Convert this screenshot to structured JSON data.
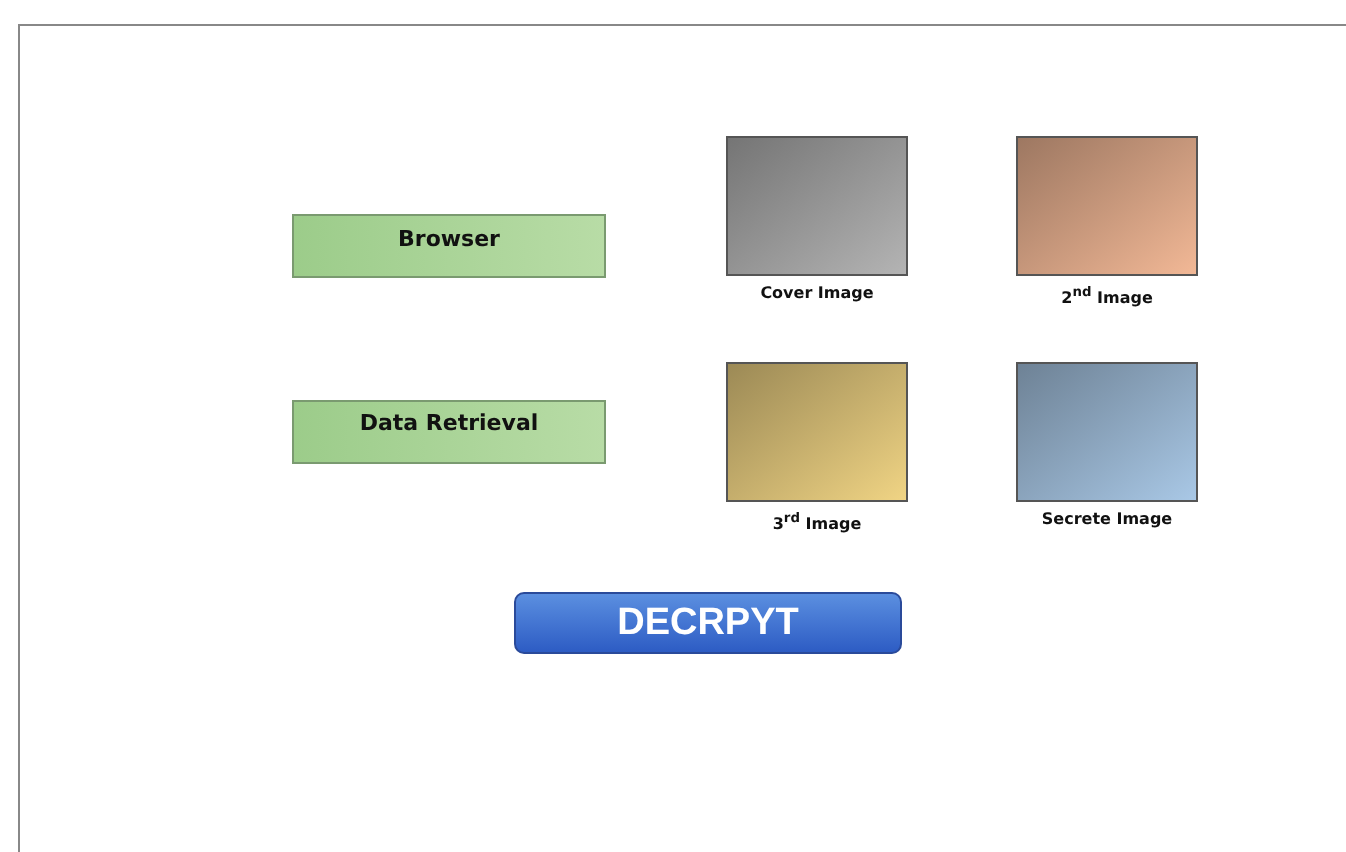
{
  "rows": [
    {
      "button": {
        "label": "Browser"
      },
      "images": [
        {
          "label": "Cover Image",
          "color": "#b4b4b4"
        },
        {
          "label": "2$^{nd}$ Image",
          "color": "#f2b896"
        }
      ]
    },
    {
      "button": {
        "label": "Data Retrieval"
      },
      "images": [
        {
          "label": "3$^{rd}$ Image",
          "color": "#f0d484"
        },
        {
          "label": "Secrete Image",
          "color": "#a9c8e6"
        }
      ]
    }
  ],
  "decrypt_button": {
    "label": "DECRPYT"
  }
}
